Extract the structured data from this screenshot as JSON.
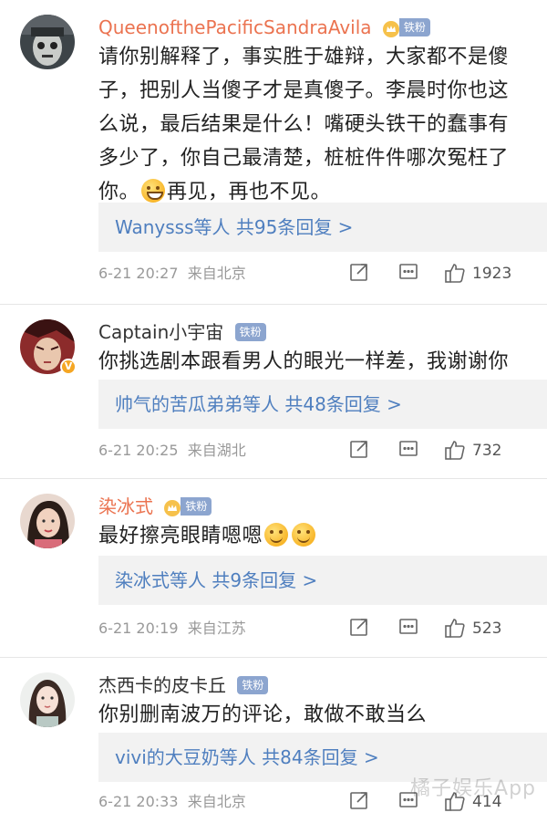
{
  "comments": [
    {
      "user": "QueenofthePacificSandraAvila",
      "badge": "铁粉",
      "text": "请你别解释了，事实胜于雄辩，大家都不是傻子，把别人当傻子才是真傻子。李晨时你也这么说，最后结果是什么！嘴硬头铁干的蠢事有多少了，你自己最清楚，桩桩件件哪次冤枉了你。",
      "text_tail": "再见，再也不见。",
      "reply": "Wanysss等人 共95条回复 >",
      "time": "6-21 20:27",
      "location": "来自北京",
      "likes": "1923"
    },
    {
      "user": "Captain小宇宙",
      "badge": "铁粉",
      "verified": "V",
      "text": "你挑选剧本跟看男人的眼光一样差，我谢谢你",
      "reply": "帅气的苦瓜弟弟等人 共48条回复 >",
      "time": "6-21 20:25",
      "location": "来自湖北",
      "likes": "732"
    },
    {
      "user": "染冰式",
      "badge": "铁粉",
      "text": "最好擦亮眼睛嗯嗯",
      "reply": "染冰式等人 共9条回复 >",
      "time": "6-21 20:19",
      "location": "来自江苏",
      "likes": "523"
    },
    {
      "user": "杰西卡的皮卡丘",
      "badge": "铁粉",
      "text": "你别删南波万的评论，敢做不敢当么",
      "reply": "vivi的大豆奶等人 共84条回复 >",
      "time": "6-21 20:33",
      "location": "来自北京",
      "likes": "414"
    }
  ],
  "watermark": "橘子娱乐App",
  "colors": {
    "username_orange": "#eb7350",
    "reply_link": "#4f7fbf",
    "badge_bg": "#8ca5cf",
    "meta_gray": "#999999"
  },
  "icons": [
    "share-icon",
    "comment-icon",
    "like-icon",
    "crown-icon",
    "grin-emoji",
    "smile-emoji"
  ]
}
